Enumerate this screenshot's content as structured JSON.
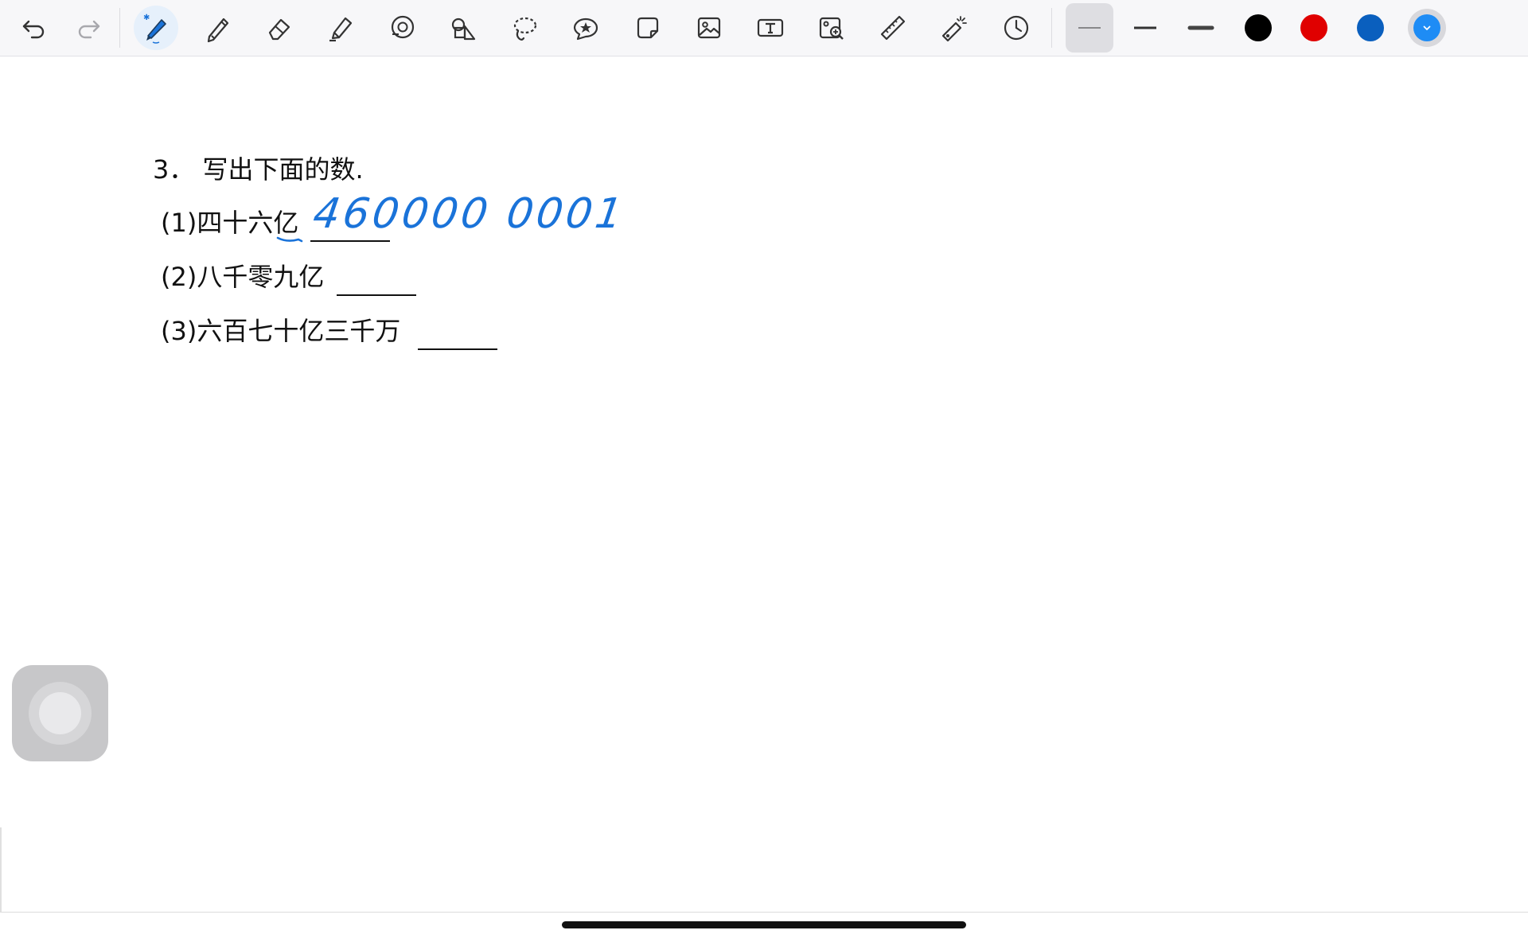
{
  "toolbar": {
    "tools": [
      {
        "name": "undo",
        "icon": "undo-icon"
      },
      {
        "name": "redo",
        "icon": "redo-icon"
      },
      {
        "name": "pen",
        "icon": "pen-icon",
        "active": true
      },
      {
        "name": "pencil",
        "icon": "pencil-icon"
      },
      {
        "name": "eraser",
        "icon": "eraser-icon"
      },
      {
        "name": "highlighter",
        "icon": "highlighter-icon"
      },
      {
        "name": "shape",
        "icon": "shape-icon"
      },
      {
        "name": "shapes",
        "icon": "shapes-icon"
      },
      {
        "name": "lasso",
        "icon": "lasso-icon"
      },
      {
        "name": "sticker",
        "icon": "star-sticker-icon"
      },
      {
        "name": "sticky-note",
        "icon": "sticky-note-icon"
      },
      {
        "name": "image",
        "icon": "image-icon"
      },
      {
        "name": "text",
        "icon": "text-box-icon"
      },
      {
        "name": "image-search",
        "icon": "image-search-icon"
      },
      {
        "name": "ruler",
        "icon": "ruler-icon"
      },
      {
        "name": "laser-pointer",
        "icon": "laser-pointer-icon"
      },
      {
        "name": "history",
        "icon": "clock-icon"
      }
    ],
    "stroke_widths": [
      "thin",
      "medium",
      "thick"
    ],
    "selected_stroke": "thin",
    "colors": [
      "#000000",
      "#e00000",
      "#0a5fbe"
    ],
    "current_color": "#1e8cf5"
  },
  "worksheet": {
    "title": "3． 写出下面的数.",
    "items": [
      {
        "label": "(1)四十六亿"
      },
      {
        "label": "(2)八千零九亿"
      },
      {
        "label": "(3)六百七十亿三千万"
      }
    ],
    "handwritten_answer": "460000 0001"
  }
}
